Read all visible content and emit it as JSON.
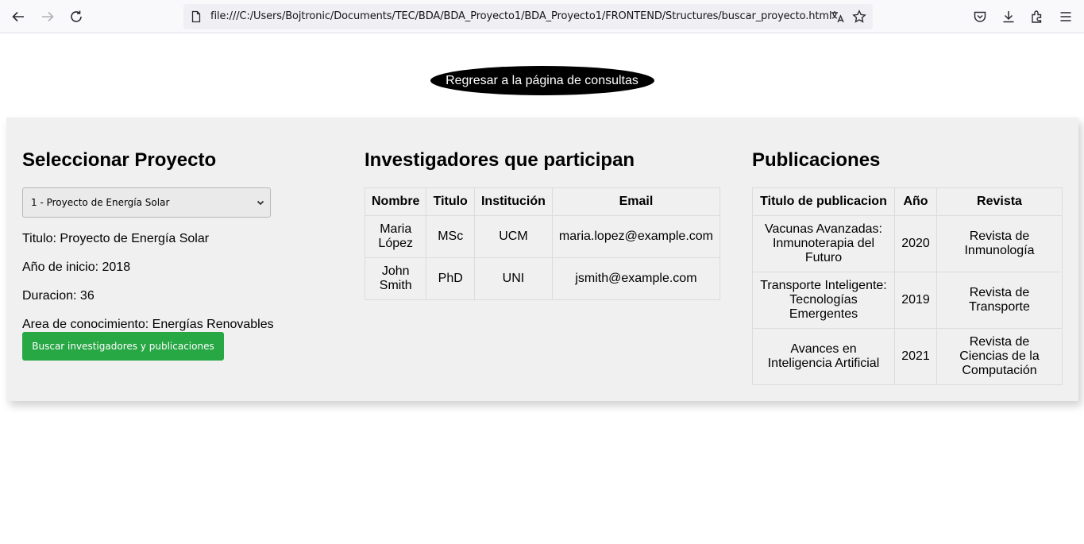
{
  "browser": {
    "url": "file:///C:/Users/Bojtronic/Documents/TEC/BDA/BDA_Proyecto1/BDA_Proyecto1/FRONTEND/Structures/buscar_proyecto.html"
  },
  "back_button_label": "Regresar a la página de consultas",
  "project_selector": {
    "title": "Seleccionar Proyecto",
    "selected_option": "1 - Proyecto de Energía Solar",
    "details": {
      "titulo": "Titulo: Proyecto de Energía Solar",
      "anio_inicio": "Año de inicio: 2018",
      "duracion": "Duracion: 36",
      "area": "Area de conocimiento: Energías Renovables"
    },
    "search_button": "Buscar investigadores y publicaciones"
  },
  "researchers": {
    "title": "Investigadores que participan",
    "columns": [
      "Nombre",
      "Titulo",
      "Institución",
      "Email"
    ],
    "rows": [
      [
        "Maria López",
        "MSc",
        "UCM",
        "maria.lopez@example.com"
      ],
      [
        "John Smith",
        "PhD",
        "UNI",
        "jsmith@example.com"
      ]
    ]
  },
  "publications": {
    "title": "Publicaciones",
    "columns": [
      "Titulo de publicacion",
      "Año",
      "Revista"
    ],
    "rows": [
      [
        "Vacunas Avanzadas: Inmunoterapia del Futuro",
        "2020",
        "Revista de Inmunología"
      ],
      [
        "Transporte Inteligente: Tecnologías Emergentes",
        "2019",
        "Revista de Transporte"
      ],
      [
        "Avances en Inteligencia Artificial",
        "2021",
        "Revista de Ciencias de la Computación"
      ]
    ]
  },
  "colors": {
    "panel_bg": "#f0f0f0",
    "search_button_bg": "#28a745",
    "back_button_bg": "#000000"
  }
}
